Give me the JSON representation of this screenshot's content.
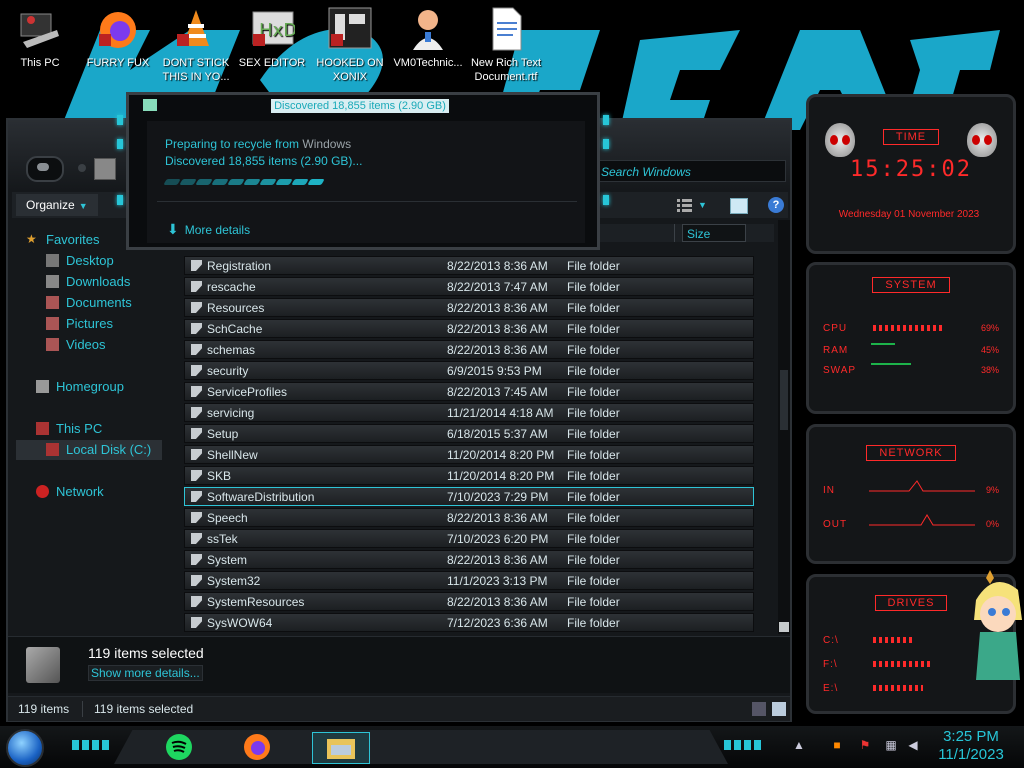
{
  "desktop": {
    "icons": [
      {
        "label": "This PC"
      },
      {
        "label": "FURRY FUX"
      },
      {
        "label": "DONT STICK THIS IN YO..."
      },
      {
        "label": "SEX EDITOR"
      },
      {
        "label": "HOOKED ON XONIX"
      },
      {
        "label": "VM0Technic..."
      },
      {
        "label": "New Rich Text Document.rtf"
      }
    ]
  },
  "explorer": {
    "search_placeholder": "Search Windows",
    "toolbar": {
      "organize_label": "Organize"
    },
    "nav": {
      "favorites": "Favorites",
      "desktop": "Desktop",
      "downloads": "Downloads",
      "documents": "Documents",
      "pictures": "Pictures",
      "videos": "Videos",
      "homegroup": "Homegroup",
      "this_pc": "This PC",
      "local_disk": "Local Disk (C:)",
      "network": "Network"
    },
    "column_size": "Size",
    "rows": [
      {
        "name": "Registration",
        "date": "8/22/2013 8:36 AM",
        "type": "File folder"
      },
      {
        "name": "rescache",
        "date": "8/22/2013 7:47 AM",
        "type": "File folder"
      },
      {
        "name": "Resources",
        "date": "8/22/2013 8:36 AM",
        "type": "File folder"
      },
      {
        "name": "SchCache",
        "date": "8/22/2013 8:36 AM",
        "type": "File folder"
      },
      {
        "name": "schemas",
        "date": "8/22/2013 8:36 AM",
        "type": "File folder"
      },
      {
        "name": "security",
        "date": "6/9/2015 9:53 PM",
        "type": "File folder"
      },
      {
        "name": "ServiceProfiles",
        "date": "8/22/2013 7:45 AM",
        "type": "File folder"
      },
      {
        "name": "servicing",
        "date": "11/21/2014 4:18 AM",
        "type": "File folder"
      },
      {
        "name": "Setup",
        "date": "6/18/2015 5:37 AM",
        "type": "File folder"
      },
      {
        "name": "ShellNew",
        "date": "11/20/2014 8:20 PM",
        "type": "File folder"
      },
      {
        "name": "SKB",
        "date": "11/20/2014 8:20 PM",
        "type": "File folder"
      },
      {
        "name": "SoftwareDistribution",
        "date": "7/10/2023 7:29 PM",
        "type": "File folder"
      },
      {
        "name": "Speech",
        "date": "8/22/2013 8:36 AM",
        "type": "File folder"
      },
      {
        "name": "ssTek",
        "date": "7/10/2023 6:20 PM",
        "type": "File folder"
      },
      {
        "name": "System",
        "date": "8/22/2013 8:36 AM",
        "type": "File folder"
      },
      {
        "name": "System32",
        "date": "11/1/2023 3:13 PM",
        "type": "File folder"
      },
      {
        "name": "SystemResources",
        "date": "8/22/2013 8:36 AM",
        "type": "File folder"
      },
      {
        "name": "SysWOW64",
        "date": "7/12/2023 6:36 AM",
        "type": "File folder"
      }
    ],
    "details": {
      "selected": "119 items selected",
      "show_more": "Show more details..."
    },
    "status": {
      "items": "119 items",
      "selected": "119 items selected"
    }
  },
  "dialog": {
    "title": "Discovered 18,855 items (2.90 GB)",
    "preparing": "Preparing to recycle from",
    "source": "Windows",
    "discovered": "Discovered 18,855 items (2.90 GB)...",
    "more_details": "More details"
  },
  "gadgets": {
    "time_title": "TIME",
    "time": "15:25:02",
    "date": "Wednesday 01 November 2023",
    "system_title": "SYSTEM",
    "cpu_label": "CPU",
    "cpu_value": "69%",
    "ram_label": "RAM",
    "ram_value": "45%",
    "swap_label": "SWAP",
    "swap_value": "38%",
    "network_title": "NETWORK",
    "in_label": "IN",
    "in_value": "9%",
    "out_label": "OUT",
    "out_value": "0%",
    "drives_title": "DRIVES",
    "drive_c": "C:\\",
    "drive_f": "F:\\",
    "drive_e": "E:\\"
  },
  "taskbar": {
    "time": "3:25 PM",
    "date": "11/1/2023"
  },
  "colors": {
    "accent": "#2ec4d6",
    "gadget_red": "#ff2a2a"
  }
}
